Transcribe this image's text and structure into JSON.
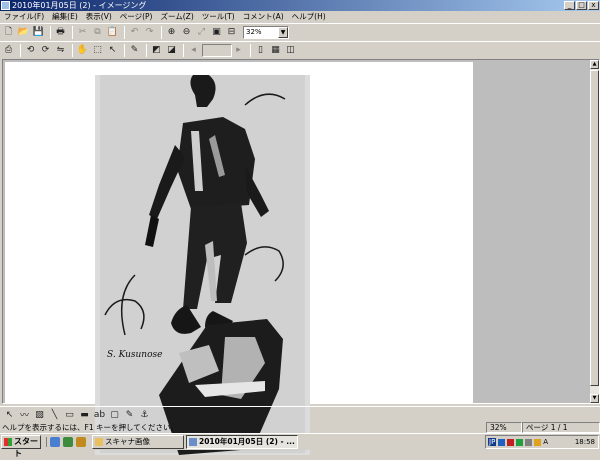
{
  "window": {
    "title": "2010年01月05日 (2) - イメージング"
  },
  "titlebar_buttons": [
    "_",
    "□",
    "x"
  ],
  "menu": [
    "ファイル(F)",
    "編集(E)",
    "表示(V)",
    "ページ(P)",
    "ズーム(Z)",
    "ツール(T)",
    "コメント(A)",
    "ヘルプ(H)"
  ],
  "toolbar": {
    "zoom_value": "32%"
  },
  "artwork": {
    "signature": "S. Kusunose"
  },
  "status": {
    "help_text": "ヘルプを表示するには、F1 キーを押してください。",
    "zoom": "32%",
    "page": "ページ 1 / 1"
  },
  "taskbar": {
    "start_label": "スタート",
    "task_items": [
      {
        "label": "スキャナ画像"
      },
      {
        "label": "2010年01月05日 (2) - ..."
      }
    ],
    "tray_lang": "JP",
    "tray_ime": "A",
    "clock": "18:58"
  },
  "colors": {
    "title_start": "#0a246a",
    "title_end": "#a6caf0",
    "face": "#d4d0c8"
  }
}
